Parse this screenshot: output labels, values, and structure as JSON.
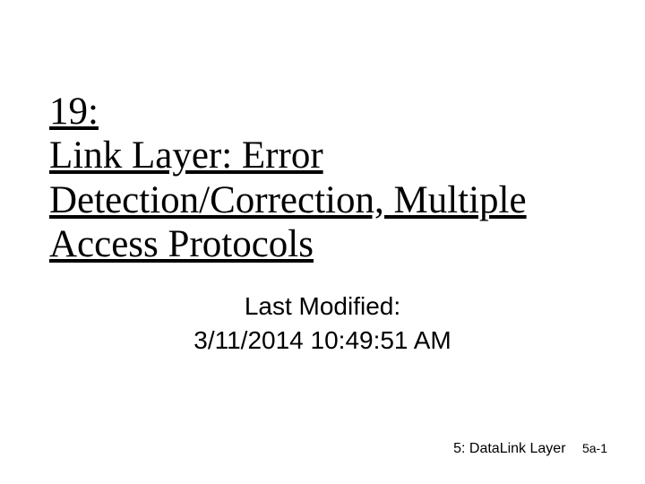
{
  "title": "19:\nLink Layer: Error Detection/Correction, Multiple Access Protocols",
  "last_modified_label": "Last Modified:",
  "last_modified_date": "3/11/2014 10:49:51 AM",
  "footer": {
    "chapter": "5: DataLink Layer",
    "page": "5a-1"
  }
}
